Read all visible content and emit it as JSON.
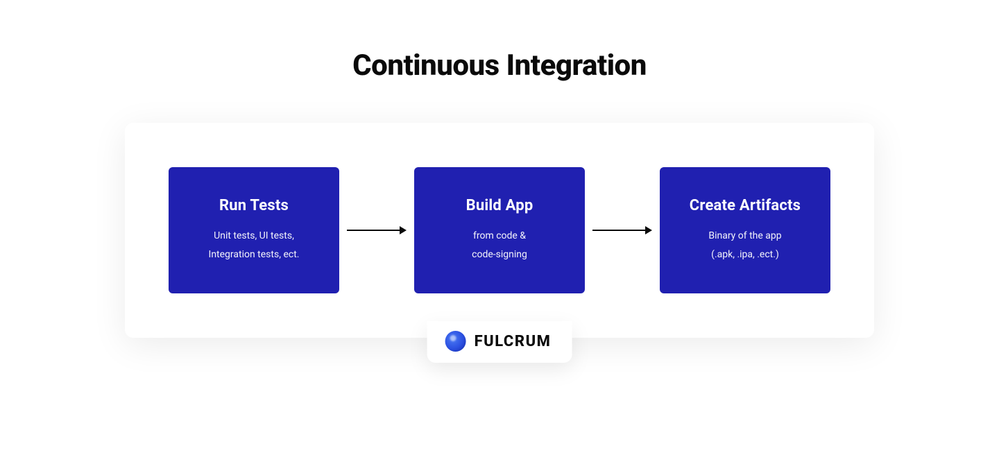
{
  "title": "Continuous Integration",
  "steps": [
    {
      "title": "Run Tests",
      "line1": "Unit tests, UI tests,",
      "line2": "Integration tests, ect."
    },
    {
      "title": "Build App",
      "line1": "from code &",
      "line2": "code-signing"
    },
    {
      "title": "Create Artifacts",
      "line1": "Binary of the app",
      "line2": "(.apk, .ipa, .ect.)"
    }
  ],
  "brand": {
    "name": "FULCRUM"
  },
  "colors": {
    "box_bg": "#2020b0",
    "text_dark": "#0a0a0a",
    "text_light": "#ffffff"
  }
}
